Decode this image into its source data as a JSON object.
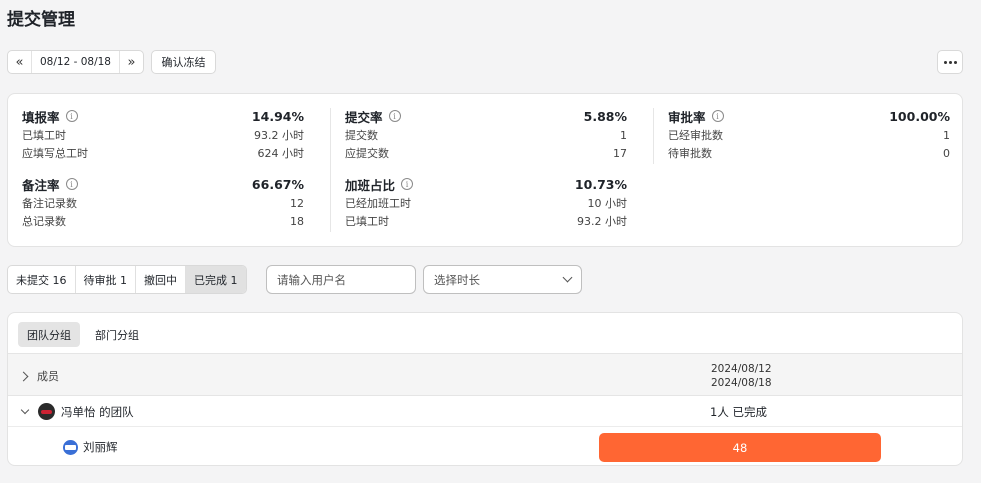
{
  "page": {
    "title": "提交管理"
  },
  "toolbar": {
    "prev_icon": "double-chevron-left-icon",
    "next_icon": "double-chevron-right-icon",
    "date_range": "08/12 - 08/18",
    "freeze_label": "确认冻结",
    "more_icon": "more-horizontal-icon"
  },
  "stats": [
    {
      "name": "填报率",
      "pct": "14.94%",
      "rows": [
        {
          "label": "已填工时",
          "value": "93.2 小时"
        },
        {
          "label": "应填写总工时",
          "value": "624 小时"
        }
      ]
    },
    {
      "name": "提交率",
      "pct": "5.88%",
      "rows": [
        {
          "label": "提交数",
          "value": "1"
        },
        {
          "label": "应提交数",
          "value": "17"
        }
      ]
    },
    {
      "name": "审批率",
      "pct": "100.00%",
      "rows": [
        {
          "label": "已经审批数",
          "value": "1"
        },
        {
          "label": "待审批数",
          "value": "0"
        }
      ]
    },
    {
      "name": "备注率",
      "pct": "66.67%",
      "rows": [
        {
          "label": "备注记录数",
          "value": "12"
        },
        {
          "label": "总记录数",
          "value": "18"
        }
      ]
    },
    {
      "name": "加班占比",
      "pct": "10.73%",
      "rows": [
        {
          "label": "已经加班工时",
          "value": "10 小时"
        },
        {
          "label": "已填工时",
          "value": "93.2 小时"
        }
      ]
    }
  ],
  "filters": {
    "status_tabs": [
      "未提交 16",
      "待审批 1",
      "撤回中",
      "已完成 1"
    ],
    "active_status": "已完成 1",
    "user_placeholder": "请输入用户名",
    "duration_placeholder": "选择时长"
  },
  "table": {
    "group_tabs": [
      "团队分组",
      "部门分组"
    ],
    "active_group": "团队分组",
    "member_header": "成员",
    "date_header_start": "2024/08/12",
    "date_header_end": "2024/08/18",
    "team": {
      "name": "冯单怡 的团队",
      "summary": "1人 已完成"
    },
    "members": [
      {
        "name": "刘丽辉",
        "hours": "48",
        "status_color": "#ff6633"
      }
    ]
  }
}
